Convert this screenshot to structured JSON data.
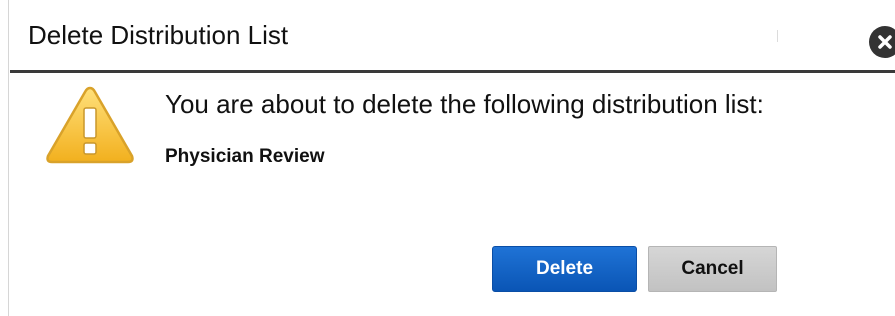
{
  "dialog": {
    "title": "Delete Distribution List",
    "close_icon": "close-circle-icon",
    "warning_icon": "warning-triangle-icon",
    "message": "You are about to delete the following distribution list:",
    "list_name": "Physician Review",
    "buttons": {
      "delete_label": "Delete",
      "cancel_label": "Cancel"
    }
  },
  "colors": {
    "primary_button": "#0a55b5",
    "secondary_button": "#c8c8c8",
    "warning": "#f4c430",
    "title_rule": "#3a3a3a"
  }
}
